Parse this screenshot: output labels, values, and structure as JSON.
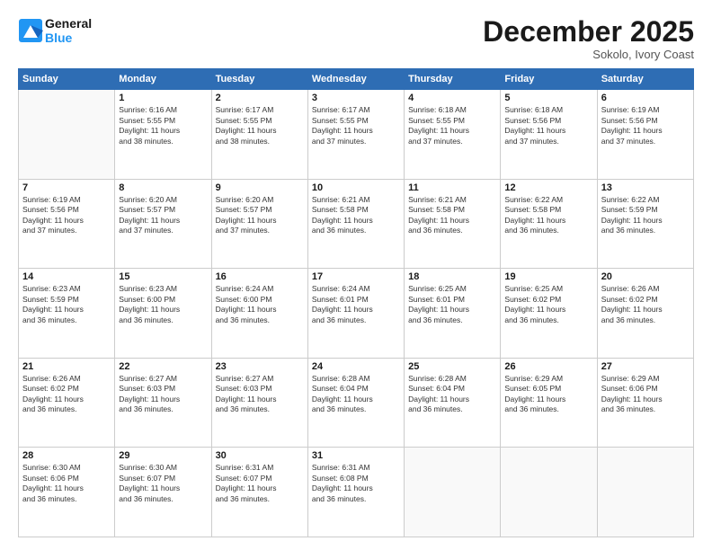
{
  "header": {
    "logo_line1": "General",
    "logo_line2": "Blue",
    "month": "December 2025",
    "location": "Sokolo, Ivory Coast"
  },
  "weekdays": [
    "Sunday",
    "Monday",
    "Tuesday",
    "Wednesday",
    "Thursday",
    "Friday",
    "Saturday"
  ],
  "weeks": [
    [
      {
        "day": "",
        "info": ""
      },
      {
        "day": "1",
        "info": "Sunrise: 6:16 AM\nSunset: 5:55 PM\nDaylight: 11 hours\nand 38 minutes."
      },
      {
        "day": "2",
        "info": "Sunrise: 6:17 AM\nSunset: 5:55 PM\nDaylight: 11 hours\nand 38 minutes."
      },
      {
        "day": "3",
        "info": "Sunrise: 6:17 AM\nSunset: 5:55 PM\nDaylight: 11 hours\nand 37 minutes."
      },
      {
        "day": "4",
        "info": "Sunrise: 6:18 AM\nSunset: 5:55 PM\nDaylight: 11 hours\nand 37 minutes."
      },
      {
        "day": "5",
        "info": "Sunrise: 6:18 AM\nSunset: 5:56 PM\nDaylight: 11 hours\nand 37 minutes."
      },
      {
        "day": "6",
        "info": "Sunrise: 6:19 AM\nSunset: 5:56 PM\nDaylight: 11 hours\nand 37 minutes."
      }
    ],
    [
      {
        "day": "7",
        "info": "Sunrise: 6:19 AM\nSunset: 5:56 PM\nDaylight: 11 hours\nand 37 minutes."
      },
      {
        "day": "8",
        "info": "Sunrise: 6:20 AM\nSunset: 5:57 PM\nDaylight: 11 hours\nand 37 minutes."
      },
      {
        "day": "9",
        "info": "Sunrise: 6:20 AM\nSunset: 5:57 PM\nDaylight: 11 hours\nand 37 minutes."
      },
      {
        "day": "10",
        "info": "Sunrise: 6:21 AM\nSunset: 5:58 PM\nDaylight: 11 hours\nand 36 minutes."
      },
      {
        "day": "11",
        "info": "Sunrise: 6:21 AM\nSunset: 5:58 PM\nDaylight: 11 hours\nand 36 minutes."
      },
      {
        "day": "12",
        "info": "Sunrise: 6:22 AM\nSunset: 5:58 PM\nDaylight: 11 hours\nand 36 minutes."
      },
      {
        "day": "13",
        "info": "Sunrise: 6:22 AM\nSunset: 5:59 PM\nDaylight: 11 hours\nand 36 minutes."
      }
    ],
    [
      {
        "day": "14",
        "info": "Sunrise: 6:23 AM\nSunset: 5:59 PM\nDaylight: 11 hours\nand 36 minutes."
      },
      {
        "day": "15",
        "info": "Sunrise: 6:23 AM\nSunset: 6:00 PM\nDaylight: 11 hours\nand 36 minutes."
      },
      {
        "day": "16",
        "info": "Sunrise: 6:24 AM\nSunset: 6:00 PM\nDaylight: 11 hours\nand 36 minutes."
      },
      {
        "day": "17",
        "info": "Sunrise: 6:24 AM\nSunset: 6:01 PM\nDaylight: 11 hours\nand 36 minutes."
      },
      {
        "day": "18",
        "info": "Sunrise: 6:25 AM\nSunset: 6:01 PM\nDaylight: 11 hours\nand 36 minutes."
      },
      {
        "day": "19",
        "info": "Sunrise: 6:25 AM\nSunset: 6:02 PM\nDaylight: 11 hours\nand 36 minutes."
      },
      {
        "day": "20",
        "info": "Sunrise: 6:26 AM\nSunset: 6:02 PM\nDaylight: 11 hours\nand 36 minutes."
      }
    ],
    [
      {
        "day": "21",
        "info": "Sunrise: 6:26 AM\nSunset: 6:02 PM\nDaylight: 11 hours\nand 36 minutes."
      },
      {
        "day": "22",
        "info": "Sunrise: 6:27 AM\nSunset: 6:03 PM\nDaylight: 11 hours\nand 36 minutes."
      },
      {
        "day": "23",
        "info": "Sunrise: 6:27 AM\nSunset: 6:03 PM\nDaylight: 11 hours\nand 36 minutes."
      },
      {
        "day": "24",
        "info": "Sunrise: 6:28 AM\nSunset: 6:04 PM\nDaylight: 11 hours\nand 36 minutes."
      },
      {
        "day": "25",
        "info": "Sunrise: 6:28 AM\nSunset: 6:04 PM\nDaylight: 11 hours\nand 36 minutes."
      },
      {
        "day": "26",
        "info": "Sunrise: 6:29 AM\nSunset: 6:05 PM\nDaylight: 11 hours\nand 36 minutes."
      },
      {
        "day": "27",
        "info": "Sunrise: 6:29 AM\nSunset: 6:06 PM\nDaylight: 11 hours\nand 36 minutes."
      }
    ],
    [
      {
        "day": "28",
        "info": "Sunrise: 6:30 AM\nSunset: 6:06 PM\nDaylight: 11 hours\nand 36 minutes."
      },
      {
        "day": "29",
        "info": "Sunrise: 6:30 AM\nSunset: 6:07 PM\nDaylight: 11 hours\nand 36 minutes."
      },
      {
        "day": "30",
        "info": "Sunrise: 6:31 AM\nSunset: 6:07 PM\nDaylight: 11 hours\nand 36 minutes."
      },
      {
        "day": "31",
        "info": "Sunrise: 6:31 AM\nSunset: 6:08 PM\nDaylight: 11 hours\nand 36 minutes."
      },
      {
        "day": "",
        "info": ""
      },
      {
        "day": "",
        "info": ""
      },
      {
        "day": "",
        "info": ""
      }
    ]
  ]
}
